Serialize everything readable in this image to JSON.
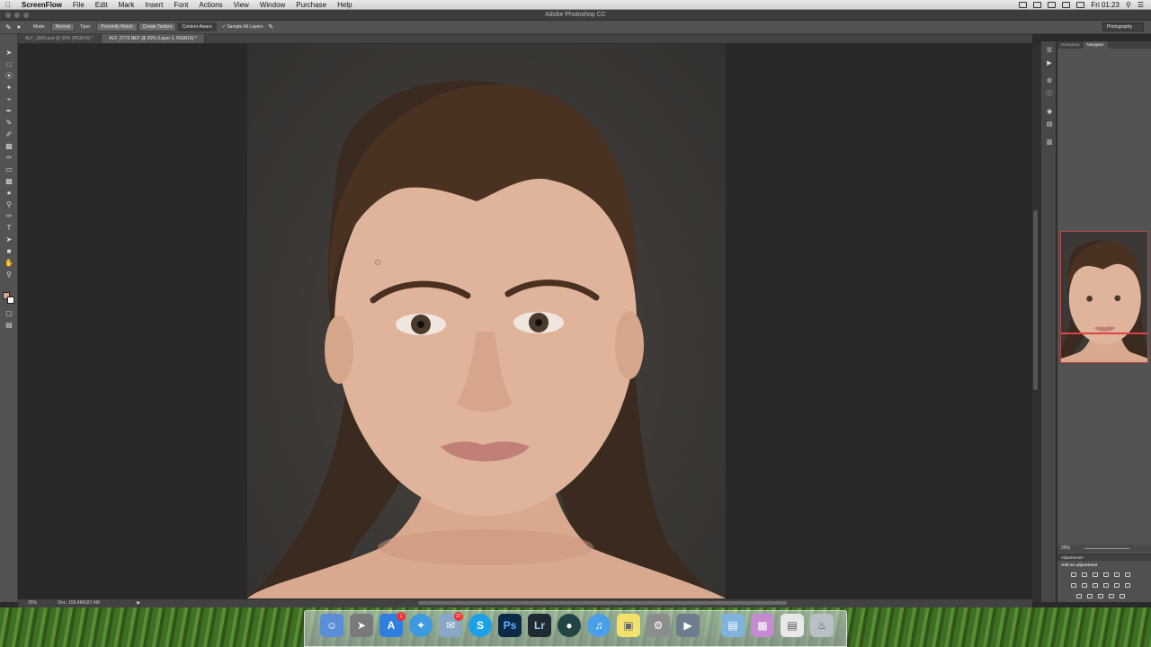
{
  "menubar": {
    "apple": "",
    "app_name": "ScreenFlow",
    "items": [
      "File",
      "Edit",
      "Mark",
      "Insert",
      "Font",
      "Actions",
      "View",
      "Window",
      "Purchase",
      "Help"
    ],
    "clock": "Fri 01:23"
  },
  "window": {
    "title": "Adobe Photoshop CC"
  },
  "options_bar": {
    "mode_label": "Mode:",
    "mode_value": "Normal",
    "type_label": "Type:",
    "type_options": [
      "Proximity Match",
      "Create Texture",
      "Content-Aware"
    ],
    "type_selected": "Content-Aware",
    "sample_all_layers": "Sample All Layers",
    "workspace": "Photography"
  },
  "tabs": [
    {
      "label": "ALF_1600.psd @ 50% (RGB/16) *",
      "active": false
    },
    {
      "label": "ALF_0772.NEF @ 25% (Layer 1, RGB/16) *",
      "active": true
    }
  ],
  "status": {
    "zoom": "25%",
    "doc": "Doc: 155.4M/187.4M"
  },
  "panels": {
    "tabs": [
      "Histogram",
      "Navigator"
    ],
    "active_tab": "Navigator",
    "navigator_zoom": "25%",
    "adjustments_title": "Adjustments",
    "adjustments_subtitle": "Add an adjustment"
  },
  "dock": {
    "items": [
      "finder-icon",
      "launchpad-icon",
      "app-store-icon",
      "safari-icon",
      "mail-icon",
      "skype-icon",
      "photoshop-icon",
      "lightroom-icon",
      "1password-icon",
      "itunes-icon",
      "stickies-icon",
      "system-preferences-icon",
      "screenflow-icon",
      "folder-icon",
      "archive-icon",
      "preview-icon",
      "trash-icon"
    ],
    "labels": {
      "ps": "Ps",
      "lr": "Lr",
      "skype": "S"
    },
    "badges": {
      "app_store": "1",
      "mail": "27"
    }
  },
  "colors": {
    "accent": "#5a8d33",
    "ui_dark": "#535353",
    "canvas": "#282828"
  }
}
